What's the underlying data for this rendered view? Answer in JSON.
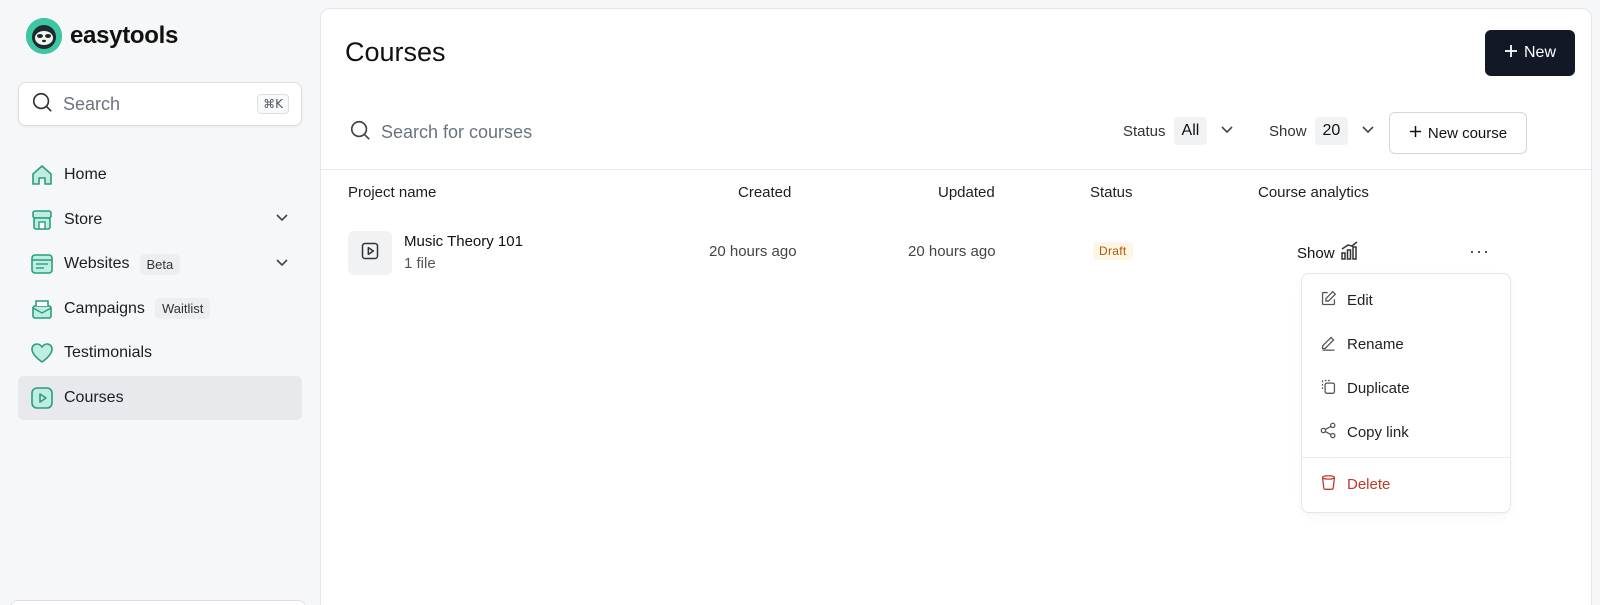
{
  "brand": {
    "name": "easytools"
  },
  "sidebar": {
    "search": {
      "placeholder": "Search",
      "shortcut": "⌘K"
    },
    "items": [
      {
        "label": "Home",
        "icon": "home-icon",
        "badge": "",
        "expandable": false,
        "active": false
      },
      {
        "label": "Store",
        "icon": "store-icon",
        "badge": "",
        "expandable": true,
        "active": false
      },
      {
        "label": "Websites",
        "icon": "websites-icon",
        "badge": "Beta",
        "expandable": true,
        "active": false
      },
      {
        "label": "Campaigns",
        "icon": "campaigns-icon",
        "badge": "Waitlist",
        "expandable": false,
        "active": false
      },
      {
        "label": "Testimonials",
        "icon": "heart-icon",
        "badge": "",
        "expandable": false,
        "active": false
      },
      {
        "label": "Courses",
        "icon": "play-icon",
        "badge": "",
        "expandable": false,
        "active": true
      }
    ]
  },
  "main": {
    "title": "Courses",
    "new_button": "New",
    "search_placeholder": "Search for courses",
    "status_filter": {
      "label": "Status",
      "value": "All"
    },
    "show_filter": {
      "label": "Show",
      "value": "20"
    },
    "new_course_button": "New course",
    "columns": [
      "Project name",
      "Created",
      "Updated",
      "Status",
      "Course analytics"
    ],
    "rows": [
      {
        "title": "Music Theory 101",
        "subtitle": "1 file",
        "created": "20 hours ago",
        "updated": "20 hours ago",
        "status": "Draft",
        "analytics": "Show"
      }
    ],
    "more_button": "···"
  },
  "row_menu": {
    "items": [
      {
        "label": "Edit",
        "icon": "edit-icon"
      },
      {
        "label": "Rename",
        "icon": "pen-icon"
      },
      {
        "label": "Duplicate",
        "icon": "copy-icon"
      },
      {
        "label": "Copy link",
        "icon": "share-icon"
      },
      {
        "label": "Delete",
        "icon": "trash-icon",
        "danger": true
      }
    ]
  },
  "colors": {
    "accent": "#3cc6a3",
    "primary_button": "#121826",
    "draft_text": "#b45309",
    "draft_bg": "#fdf6e3",
    "danger": "#c0392b"
  }
}
